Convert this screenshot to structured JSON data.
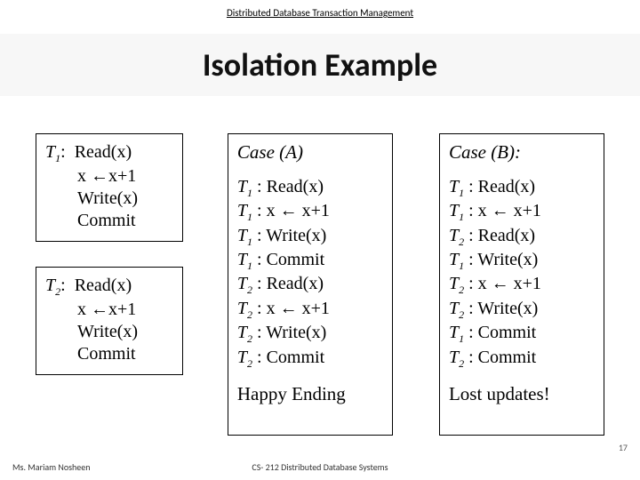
{
  "header": {
    "subject": "Distributed Database Transaction Management"
  },
  "title": "Isolation Example",
  "left": {
    "t1": {
      "name": "T",
      "sub": "1",
      "label_sep": ":",
      "lines": [
        "Read(x)",
        "x ←x+1",
        "Write(x)",
        "Commit"
      ]
    },
    "t2": {
      "name": "T",
      "sub": "2",
      "label_sep": ":",
      "lines": [
        "Read(x)",
        "x ←x+1",
        "Write(x)",
        "Commit"
      ]
    }
  },
  "caseA": {
    "title": "Case (A)",
    "steps": [
      {
        "t": "1",
        "op": "Read(x)"
      },
      {
        "t": "1",
        "op": "x ← x+1"
      },
      {
        "t": "1",
        "op": "Write(x)"
      },
      {
        "t": "1",
        "op": "Commit"
      },
      {
        "t": "2",
        "op": "Read(x)"
      },
      {
        "t": "2",
        "op": "x ← x+1"
      },
      {
        "t": "2",
        "op": "Write(x)"
      },
      {
        "t": "2",
        "op": "Commit"
      }
    ],
    "ending": "Happy Ending"
  },
  "caseB": {
    "title": "Case (B):",
    "steps": [
      {
        "t": "1",
        "op": "Read(x)"
      },
      {
        "t": "1",
        "op": "x ← x+1"
      },
      {
        "t": "2",
        "op": "Read(x)"
      },
      {
        "t": "1",
        "op": "Write(x)"
      },
      {
        "t": "2",
        "op": "x ← x+1"
      },
      {
        "t": "2",
        "op": "Write(x)"
      },
      {
        "t": "1",
        "op": "Commit"
      },
      {
        "t": "2",
        "op": "Commit"
      }
    ],
    "ending": "Lost updates!"
  },
  "footer": {
    "author": "Ms. Mariam Nosheen",
    "course": "CS- 212 Distributed Database Systems",
    "page": "17"
  }
}
